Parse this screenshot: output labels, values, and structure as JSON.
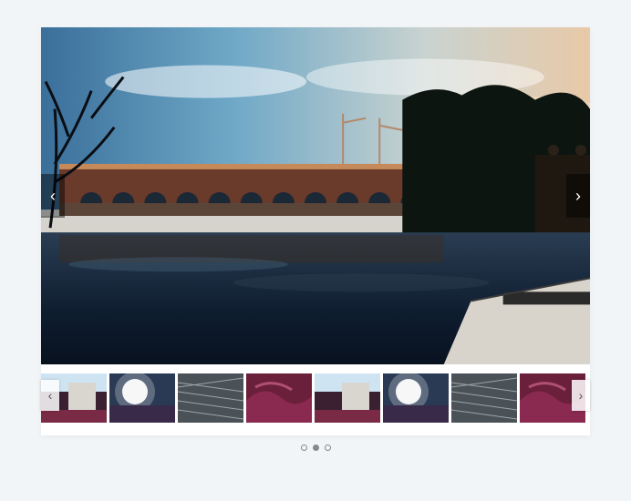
{
  "gallery": {
    "main_prev_glyph": "‹",
    "main_next_glyph": "›",
    "thumbs_prev_glyph": "‹",
    "thumbs_next_glyph": "›",
    "thumbnail_count": 8,
    "pagination": {
      "dot_count": 3,
      "active_index": 1
    },
    "colors": {
      "page_bg": "#f2f5f7",
      "overlay_dark": "rgba(0,0,0,0.45)",
      "overlay_light": "rgba(255,255,255,0.85)"
    }
  }
}
